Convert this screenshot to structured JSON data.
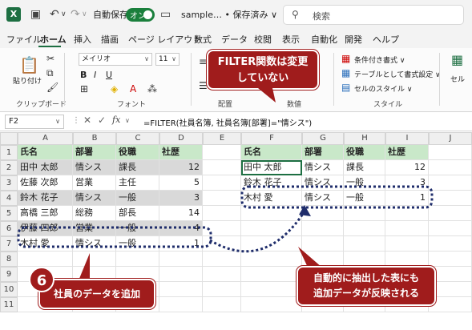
{
  "titlebar": {
    "autosave_label": "自動保存",
    "autosave_state": "オン",
    "filename": "sample… • 保存済み ∨",
    "search_placeholder": "検索"
  },
  "menu": [
    "ファイル",
    "ホーム",
    "挿入",
    "描画",
    "ページ レイアウト",
    "数式",
    "データ",
    "校閲",
    "表示",
    "自動化",
    "開発",
    "ヘルプ"
  ],
  "ribbon": {
    "paste": "貼り付け",
    "clipboard": "クリップボード",
    "font_name": "メイリオ",
    "font_size": "11",
    "font_group": "フォント",
    "align_group": "配置",
    "number_group": "数値",
    "cond_format": "条件付き書式 ∨",
    "table_format": "テーブルとして書式設定 ∨",
    "cell_style": "セルのスタイル ∨",
    "style_group": "スタイル",
    "cell_btn": "セル"
  },
  "formula_bar": {
    "name_box": "F2",
    "fx": "fx",
    "formula": "=FILTER(社員名簿, 社員名簿[部署]=\"情シス\")"
  },
  "columns": [
    "A",
    "B",
    "C",
    "D",
    "E",
    "F",
    "G",
    "H",
    "I",
    "J"
  ],
  "rows": [
    "1",
    "2",
    "3",
    "4",
    "5",
    "6",
    "7",
    "8",
    "9",
    "10",
    "11"
  ],
  "source_table": {
    "headers": [
      "氏名",
      "部署",
      "役職",
      "社歴"
    ],
    "rows": [
      [
        "田中 太郎",
        "情シス",
        "課長",
        "12"
      ],
      [
        "佐藤 次郎",
        "営業",
        "主任",
        "5"
      ],
      [
        "鈴木 花子",
        "情シス",
        "一般",
        "3"
      ],
      [
        "高橋 三郎",
        "総務",
        "部長",
        "14"
      ],
      [
        "伊藤 四郎",
        "営業",
        "一般",
        "4"
      ],
      [
        "木村 愛",
        "情シス",
        "一般",
        "1"
      ]
    ]
  },
  "filter_table": {
    "headers": [
      "氏名",
      "部署",
      "役職",
      "社歴"
    ],
    "rows": [
      [
        "田中 太郎",
        "情シス",
        "課長",
        "12"
      ],
      [
        "鈴木 花子",
        "情シス",
        "一般",
        "3"
      ],
      [
        "木村 愛",
        "情シス",
        "一般",
        "1"
      ]
    ]
  },
  "callouts": {
    "top": "FILTER関数は変更\nしていない",
    "step_number": "6",
    "bottom_left": "社員のデータを追加",
    "bottom_right": "自動的に抽出した表にも\n追加データが反映される"
  },
  "colors": {
    "accent": "#a01c1c",
    "excel_green": "#1d6f42",
    "header_fill": "#c9e8c9"
  }
}
